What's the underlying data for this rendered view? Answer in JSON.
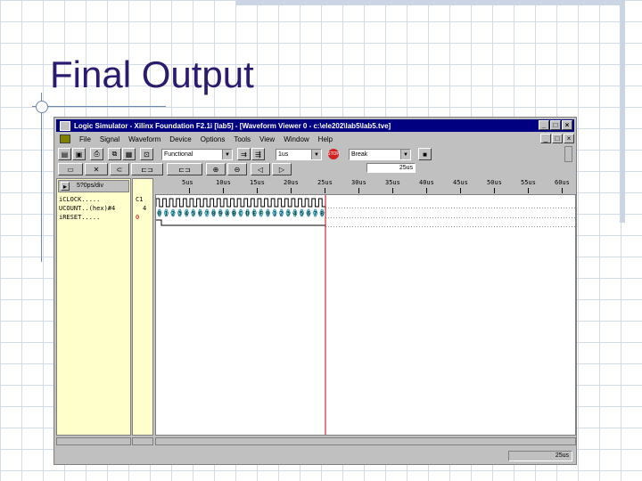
{
  "slide": {
    "title": "Final Output"
  },
  "window": {
    "title": "Logic Simulator - Xilinx Foundation F2.1i [lab5] - [Waveform Viewer 0 - c:\\ele202\\lab5\\lab5.tve]",
    "buttons": {
      "minimize": "_",
      "maximize": "□",
      "close": "×"
    }
  },
  "menu": [
    "File",
    "Signal",
    "Waveform",
    "Device",
    "Options",
    "Tools",
    "View",
    "Window",
    "Help"
  ],
  "toolbar": {
    "mode": "Functional",
    "step": "1us",
    "stop_label": "STOP",
    "breakpoint": "Break",
    "sim_time": "25us"
  },
  "toolbar2": {
    "ps_label": "5?0ps/div"
  },
  "signals": [
    {
      "prefix": "i",
      "name": "CLOCK.....",
      "value": "C1"
    },
    {
      "prefix": "U",
      "name": "COUNT..(hex)#4",
      "value": "4"
    },
    {
      "prefix": "i",
      "name": "RESET.....",
      "value": "0"
    }
  ],
  "ruler": {
    "origin": "0us",
    "ticks": [
      "5us",
      "10us",
      "15us",
      "20us",
      "25us",
      "30us",
      "35us",
      "40us",
      "45us",
      "50us",
      "55us",
      "60us"
    ]
  },
  "waveform": {
    "cursor_time_us": 25,
    "count_values": [
      "0",
      "1",
      "2",
      "3",
      "4",
      "5",
      "6",
      "7",
      "8",
      "9",
      "A",
      "B",
      "C",
      "D",
      "E",
      "F",
      "0",
      "1",
      "2",
      "3",
      "4",
      "5",
      "6",
      "7",
      "8"
    ],
    "colors": {
      "clock": "#000000",
      "bus": "#66ccdd",
      "cursor": "#c00000"
    }
  },
  "status": {
    "time": "25us"
  }
}
